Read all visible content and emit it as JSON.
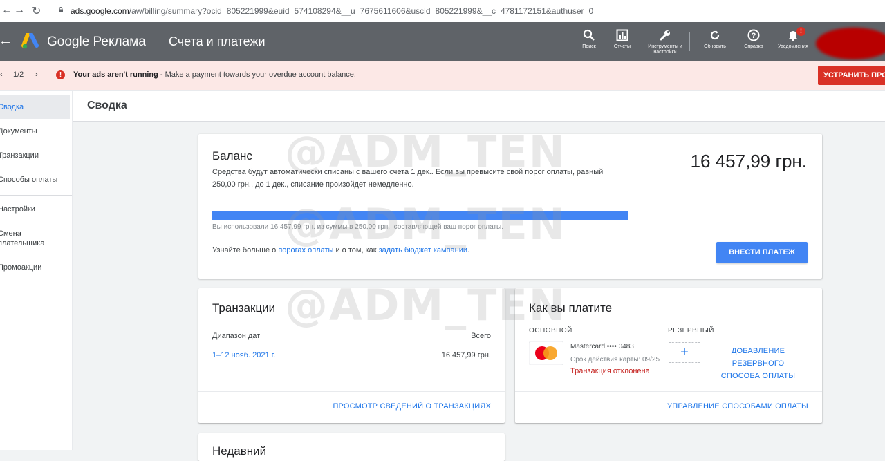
{
  "browser": {
    "url_host": "ads.google.com",
    "url_path": "/aw/billing/summary?ocid=805221999&euid=574108294&__u=7675611606&uscid=805221999&__c=4781172151&authuser=0"
  },
  "appbar": {
    "brand": "Google Реклама",
    "page_name": "Счета и платежи",
    "tools": {
      "search": "Поиск",
      "reports": "Отчеты",
      "tools": "Инструменты и настройки",
      "refresh": "Обновить",
      "help": "Справка",
      "notifications": "Уведомления"
    },
    "notification_badge": "!"
  },
  "alert": {
    "pager": "1/2",
    "title": "Your ads aren't running",
    "message": " - Make a payment towards your overdue account balance.",
    "fix_button": "УСТРАНИТЬ ПРОБЛЕМУ"
  },
  "sidebar": {
    "items": [
      {
        "label": "Сводка"
      },
      {
        "label": "Документы"
      },
      {
        "label": "Транзакции"
      },
      {
        "label": "Способы оплаты"
      },
      {
        "label": "Настройки"
      },
      {
        "label": "Смена плательщика"
      },
      {
        "label": "Промоакции"
      }
    ]
  },
  "content": {
    "title": "Сводка"
  },
  "balance": {
    "title": "Баланс",
    "amount": "16 457,99 грн.",
    "description": "Средства будут автоматически списаны с вашего счета 1 дек.. Если вы превысите свой порог оплаты, равный 250,00 грн., до 1 дек., списание произойдет немедленно.",
    "usage_text": "Вы использовали 16 457,99 грн. из суммы в 250,00 грн., составляющей ваш порог оплаты.",
    "learn_prefix": "Узнайте больше о ",
    "learn_link1": "порогах оплаты",
    "learn_middle": " и о том, как ",
    "learn_link2": "задать бюджет кампании",
    "learn_suffix": ".",
    "pay_button": "ВНЕСТИ ПЛАТЕЖ",
    "progress_fraction": 1.0
  },
  "transactions": {
    "title": "Транзакции",
    "col_date": "Диапазон дат",
    "col_total": "Всего",
    "date_range": "1–12 нояб. 2021 г.",
    "total": "16 457,99 грн.",
    "footer_link": "ПРОСМОТР СВЕДЕНИЙ О ТРАНЗАКЦИЯХ"
  },
  "payment": {
    "title": "Как вы платите",
    "primary_label": "ОСНОВНОЙ",
    "backup_label": "РЕЗЕРВНЫЙ",
    "card_name": "Mastercard •••• 0483",
    "card_expiry": "Срок действия карты: 09/25",
    "card_status": "Транзакция отклонена",
    "add_backup": "ДОБАВЛЕНИЕ РЕЗЕРВНОГО СПОСОБА ОПЛАТЫ",
    "footer_link": "УПРАВЛЕНИЕ СПОСОБАМИ ОПЛАТЫ"
  },
  "next_card": {
    "title": "Недавний"
  },
  "watermark": "@ADM_TEN",
  "colors": {
    "accent": "#1a73e8",
    "progress": "#4285f4",
    "alert_bg": "#fce8e6",
    "danger": "#d93025",
    "appbar": "#5f6368"
  }
}
